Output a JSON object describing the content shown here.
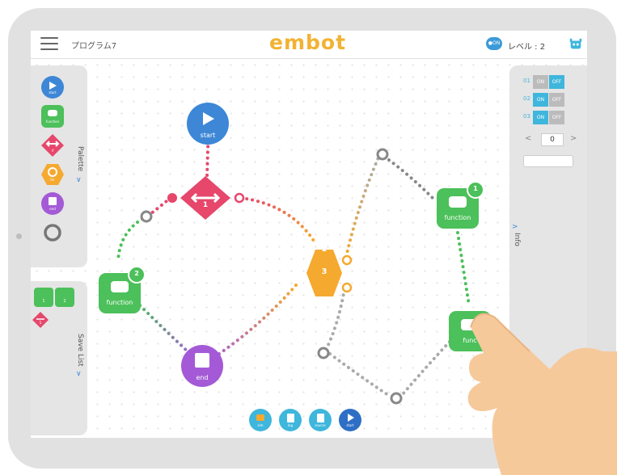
{
  "topbar": {
    "program_name": "プログラム7",
    "app_title": "embot",
    "toggle_label": "●ON",
    "level": "レベル : 2"
  },
  "palette": {
    "title": "Palette",
    "items": [
      {
        "label": "start",
        "color": "#3d87d6"
      },
      {
        "label": "function",
        "color": "#4cc05a"
      },
      {
        "label": "if",
        "color": "#e6476b"
      },
      {
        "label": "for",
        "color": "#f5a92f"
      },
      {
        "label": "end",
        "color": "#a45ad6"
      },
      {
        "label": "",
        "color": "#777777"
      }
    ]
  },
  "save_list": {
    "title": "Save List",
    "items": [
      "1",
      "2",
      "1"
    ]
  },
  "info": {
    "title": "Info",
    "rows": [
      {
        "label": "01",
        "on": "ON",
        "off": "OFF",
        "active": "off"
      },
      {
        "label": "02",
        "on": "ON",
        "off": "OFF",
        "active": "on"
      },
      {
        "label": "03",
        "on": "ON",
        "off": "OFF",
        "active": "on"
      }
    ],
    "stepper": {
      "value": "0",
      "prev": "<",
      "next": ">"
    }
  },
  "nodes": {
    "start": "start",
    "if_value": "1",
    "loop_value": "3",
    "function_left": "function",
    "function_left_badge": "2",
    "function_right": "function",
    "function_right_badge": "1",
    "function_bottom": "func",
    "end": "end"
  },
  "bottom_buttons": [
    {
      "label": "sim",
      "color": "#3fb6dc"
    },
    {
      "label": "log",
      "color": "#3fb6dc"
    },
    {
      "label": "source",
      "color": "#3fb6dc"
    },
    {
      "label": "start",
      "color": "#2d6fc4"
    }
  ],
  "colors": {
    "accent": "#f2b233",
    "blue": "#3d87d6",
    "green": "#4cc05a",
    "pink": "#e6476b",
    "orange": "#f5a92f",
    "purple": "#a45ad6",
    "cyan": "#3fb6dc"
  }
}
